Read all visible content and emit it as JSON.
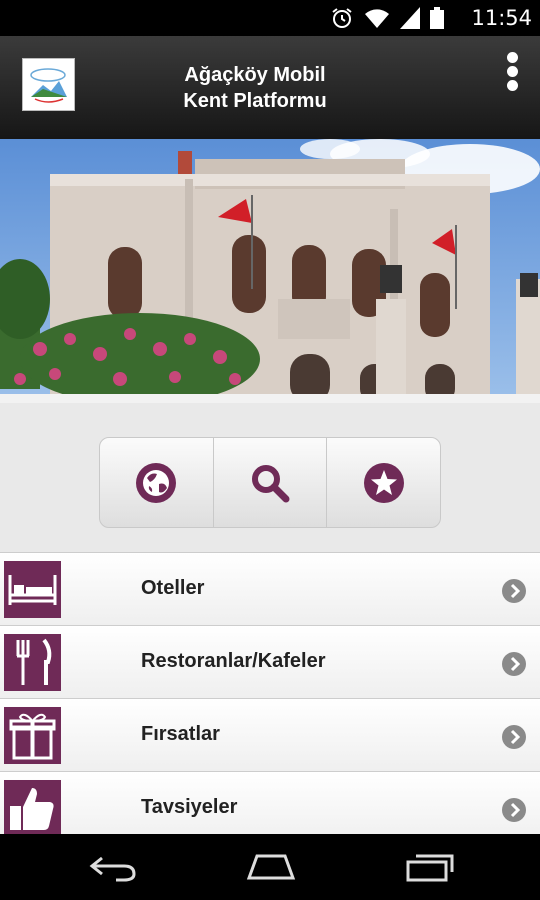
{
  "status_bar": {
    "time": "11:54",
    "icons": [
      "alarm-icon",
      "wifi-icon",
      "signal-icon",
      "battery-icon"
    ]
  },
  "app_bar": {
    "title_line1": "Ağaçköy Mobil",
    "title_line2": "Kent Platformu",
    "logo_icon": "municipality-logo",
    "menu_icon": "overflow-menu-icon"
  },
  "quick_actions": [
    {
      "icon": "globe-icon"
    },
    {
      "icon": "search-icon"
    },
    {
      "icon": "star-icon"
    }
  ],
  "categories": [
    {
      "label": "Oteller",
      "icon": "bed-icon"
    },
    {
      "label": "Restoranlar/Kafeler",
      "icon": "fork-knife-icon"
    },
    {
      "label": "Fırsatlar",
      "icon": "gift-icon"
    },
    {
      "label": "Tavsiyeler",
      "icon": "thumbs-up-icon"
    }
  ],
  "nav_bar": [
    "back-icon",
    "home-icon",
    "recent-apps-icon"
  ],
  "colors": {
    "accent": "#6f2a57",
    "appbar": "#262626",
    "chevron": "#8a8a8a"
  }
}
